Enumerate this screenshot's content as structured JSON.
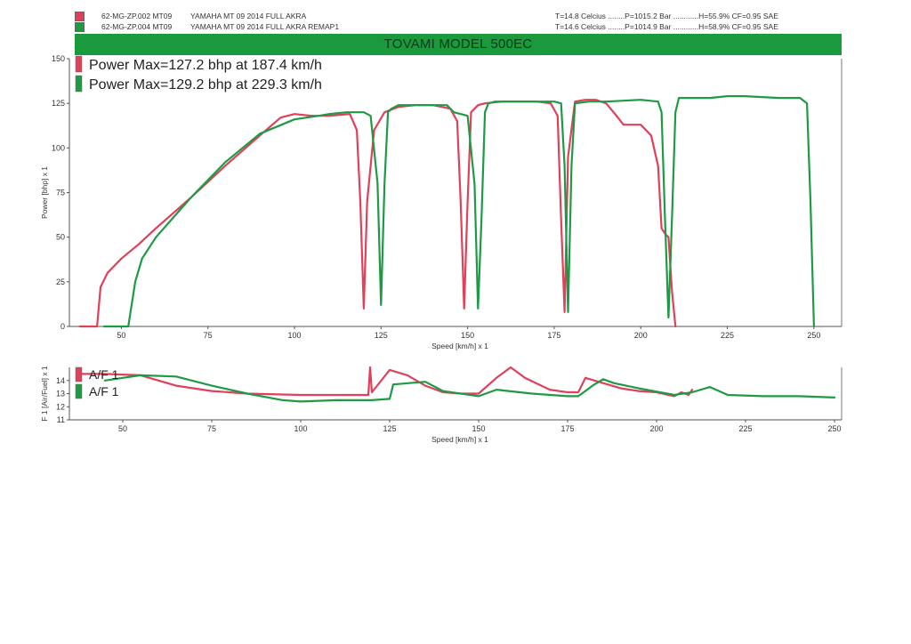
{
  "header": {
    "runs": [
      {
        "swatch_color": "#e0405a",
        "id": "62-MG-ZP.002 MT09",
        "model": "YAMAHA MT 09 2014 FULL AKRA",
        "conditions": "T=14.8 Celcius ........P=1015.2 Bar ............H=55.9% CF=0.95 SAE"
      },
      {
        "swatch_color": "#1e9a44",
        "id": "62-MG-ZP.004 MT09",
        "model": "YAMAHA MT 09 2014 FULL AKRA REMAP1",
        "conditions": "T=14.6 Celcius ........P=1014.9 Bar ............H=58.9% CF=0.95 SAE"
      }
    ],
    "banner_title": "TOVAMI MODEL 500EC"
  },
  "colors": {
    "red": "#e0405a",
    "green": "#1e9a44",
    "banner": "#1a9a3c",
    "axis": "#555555"
  },
  "chart_data": [
    {
      "type": "line",
      "xlabel": "Speed [km/h] x 1",
      "ylabel": "Power [bhp] x 1",
      "xlim": [
        35,
        258
      ],
      "ylim": [
        0,
        150
      ],
      "xticks": [
        50,
        75,
        100,
        125,
        150,
        175,
        200,
        225,
        250
      ],
      "yticks": [
        0,
        25,
        50,
        75,
        100,
        125,
        150
      ],
      "ytick_labels": [
        "0",
        "25",
        "50",
        "75",
        "100",
        "125",
        "150"
      ],
      "grid": false,
      "legend_position": "top-left",
      "series": [
        {
          "name": "Power  Max=127.2 bhp at 187.4 km/h",
          "color": "#e0405a",
          "x": [
            38,
            43,
            44,
            46,
            50,
            55,
            60,
            70,
            80,
            90,
            96,
            100,
            105,
            110,
            116,
            118,
            119,
            120,
            121,
            123,
            126,
            130,
            135,
            140,
            145,
            147,
            148,
            149,
            150,
            151,
            153,
            155,
            160,
            170,
            174,
            176,
            177,
            178,
            179,
            181,
            184,
            187,
            190,
            193,
            195,
            200,
            203,
            205,
            206,
            207,
            208,
            209,
            210
          ],
          "y": [
            0,
            0,
            22,
            30,
            38,
            46,
            55,
            72,
            90,
            107,
            117,
            119,
            118,
            118,
            119,
            110,
            70,
            10,
            70,
            110,
            120,
            123,
            124,
            124,
            122,
            115,
            70,
            10,
            70,
            120,
            124,
            125,
            126,
            126,
            125,
            118,
            60,
            8,
            95,
            126,
            127,
            127,
            125,
            118,
            113,
            113,
            107,
            90,
            55,
            52,
            50,
            20,
            0
          ]
        },
        {
          "name": "Power  Max=129.2 bhp at 229.3 km/h",
          "color": "#1e9a44",
          "x": [
            45,
            49,
            50,
            52,
            54,
            56,
            60,
            70,
            80,
            90,
            100,
            107,
            110,
            115,
            120,
            122,
            124,
            125,
            126,
            127,
            128,
            130,
            135,
            140,
            144,
            146,
            150,
            152,
            153,
            154,
            155,
            156,
            158,
            165,
            175,
            177,
            178,
            179,
            180,
            181,
            185,
            190,
            200,
            205,
            206,
            207,
            208,
            209,
            210,
            211,
            215,
            220,
            225,
            230,
            240,
            246,
            248,
            249,
            250
          ],
          "y": [
            0,
            0,
            0,
            0,
            25,
            38,
            50,
            72,
            92,
            108,
            116,
            118,
            119,
            120,
            120,
            118,
            80,
            12,
            80,
            120,
            122,
            124,
            124,
            124,
            124,
            120,
            118,
            80,
            10,
            60,
            120,
            125,
            126,
            126,
            126,
            125,
            90,
            8,
            90,
            125,
            126,
            126,
            127,
            126,
            120,
            60,
            5,
            60,
            120,
            128,
            128,
            128,
            129,
            129,
            128,
            128,
            125,
            70,
            0
          ]
        }
      ]
    },
    {
      "type": "line",
      "xlabel": "Speed [km/h] x 1",
      "ylabel": "F 1 [Air/Fuel] x 1",
      "xlim": [
        35,
        252
      ],
      "ylim": [
        11,
        15
      ],
      "xticks": [
        50,
        75,
        100,
        125,
        150,
        175,
        200,
        225,
        250
      ],
      "yticks": [
        11,
        12,
        13,
        14
      ],
      "grid": false,
      "legend_position": "top-left",
      "series": [
        {
          "name": "A/F 1",
          "color": "#e0405a",
          "x": [
            38,
            45,
            55,
            65,
            75,
            85,
            100,
            110,
            119,
            119.5,
            120,
            125,
            130,
            135,
            140,
            145,
            150,
            155,
            159,
            163,
            170,
            175,
            178,
            180,
            185,
            190,
            195,
            200,
            205,
            207,
            209,
            210
          ],
          "y": [
            14.5,
            14.5,
            14.4,
            13.6,
            13.2,
            13,
            12.9,
            12.9,
            12.9,
            15,
            13.1,
            14.8,
            14.4,
            13.6,
            13.1,
            13,
            13,
            14.2,
            15,
            14.2,
            13.3,
            13.1,
            13.1,
            14.2,
            13.8,
            13.4,
            13.2,
            13.1,
            12.8,
            13.1,
            12.9,
            13.3
          ]
        },
        {
          "name": "A/F 1",
          "color": "#1e9a44",
          "x": [
            45,
            50,
            55,
            65,
            75,
            85,
            95,
            100,
            110,
            120,
            125,
            126,
            135,
            140,
            150,
            155,
            165,
            175,
            178,
            180,
            182,
            185,
            188,
            195,
            205,
            210,
            215,
            220,
            230,
            240,
            250
          ],
          "y": [
            14,
            14.2,
            14.4,
            14.3,
            13.6,
            13,
            12.5,
            12.4,
            12.5,
            12.5,
            12.6,
            13.7,
            13.9,
            13.2,
            12.8,
            13.3,
            13,
            12.8,
            12.8,
            13.2,
            13.6,
            14.1,
            13.8,
            13.4,
            12.9,
            13.1,
            13.5,
            12.9,
            12.8,
            12.8,
            12.7
          ]
        }
      ]
    }
  ]
}
